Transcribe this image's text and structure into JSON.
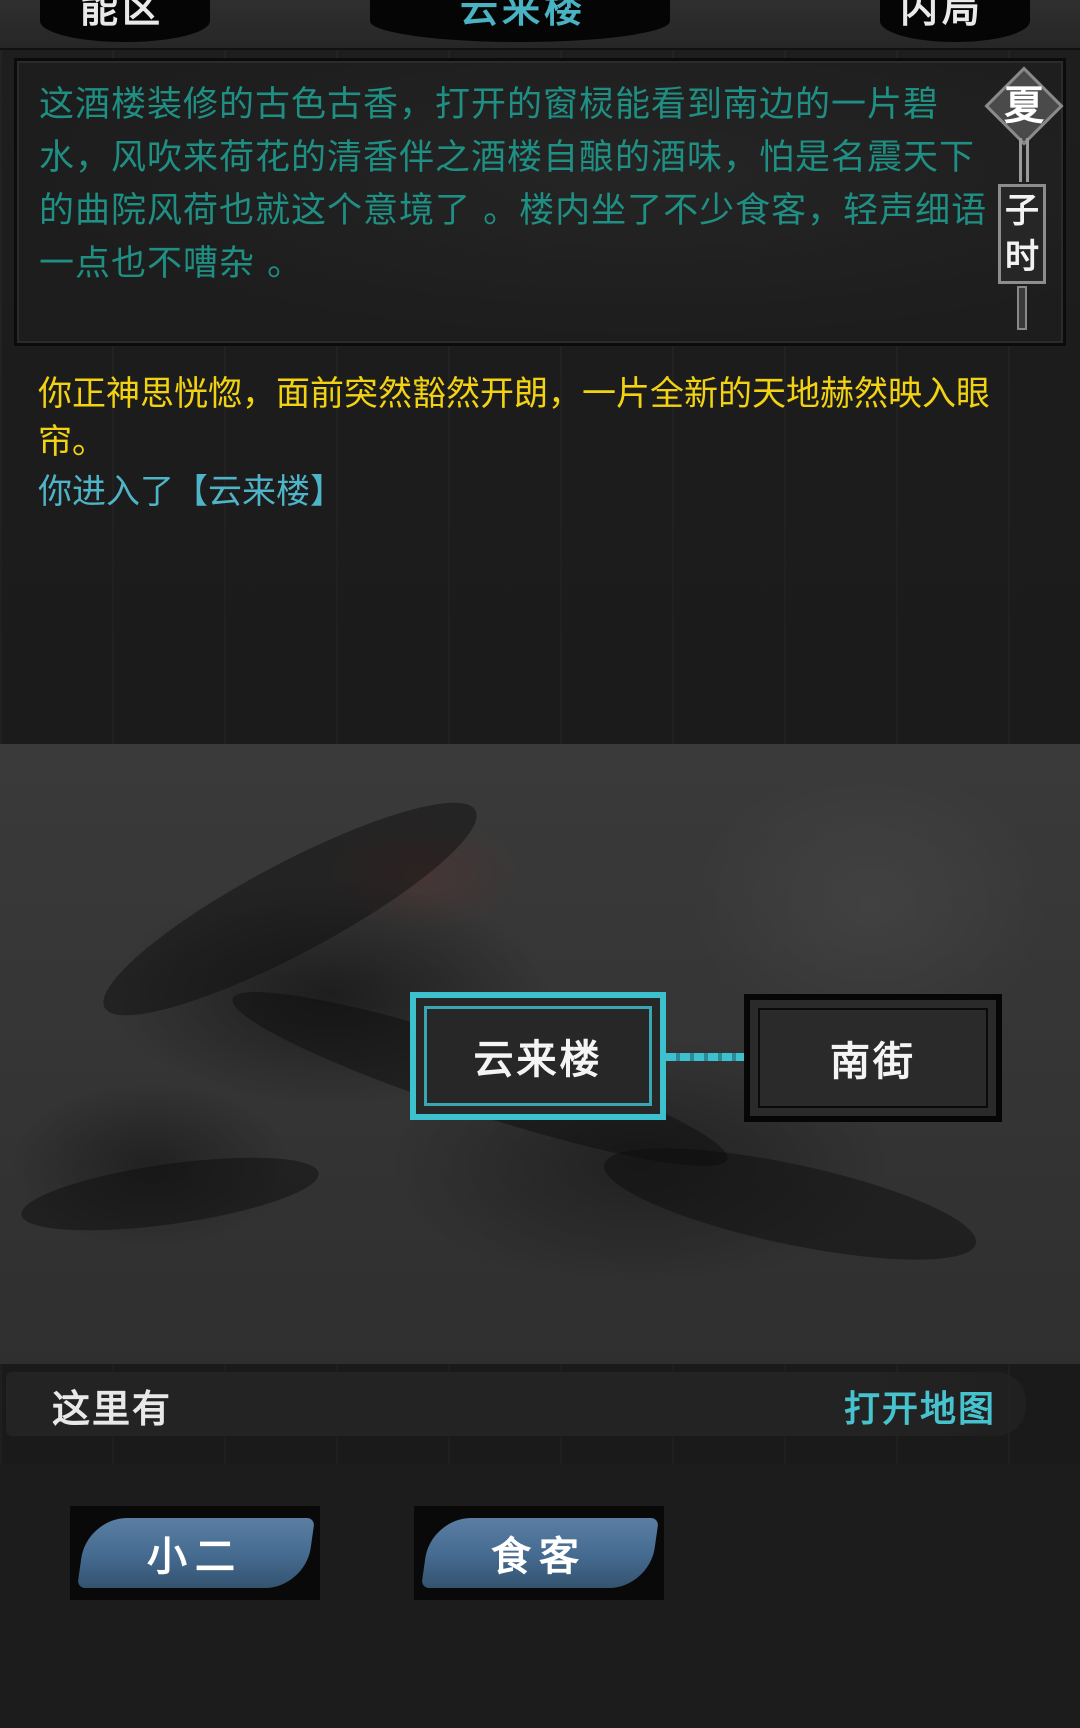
{
  "header": {
    "left_text": "能区",
    "center_text": "云来楼",
    "right_text": "内局"
  },
  "description": {
    "text": "这酒楼装修的古色古香，打开的窗棂能看到南边的一片碧水，风吹来荷花的清香伴之酒楼自酿的酒味，怕是名震天下的曲院风荷也就这个意境了 。楼内坐了不少食客，轻声细语一点也不嘈杂 。"
  },
  "season_badge": {
    "season": "夏",
    "time": "子时"
  },
  "log": {
    "line1": "你正神思恍惚，面前突然豁然开朗，一片全新的天地赫然映入眼帘。",
    "line2": "你进入了【云来楼】"
  },
  "map": {
    "current_location": "云来楼",
    "adjacent_location": "南街"
  },
  "here_bar": {
    "label": "这里有",
    "open_map": "打开地图"
  },
  "npcs": [
    "小二",
    "食客"
  ],
  "colors": {
    "description_text": "#1f8f84",
    "log_yellow": "#f3d311",
    "log_cyan": "#4fb4c8",
    "accent_cyan": "#3ec1cf",
    "npc_button": "#456a8f"
  }
}
